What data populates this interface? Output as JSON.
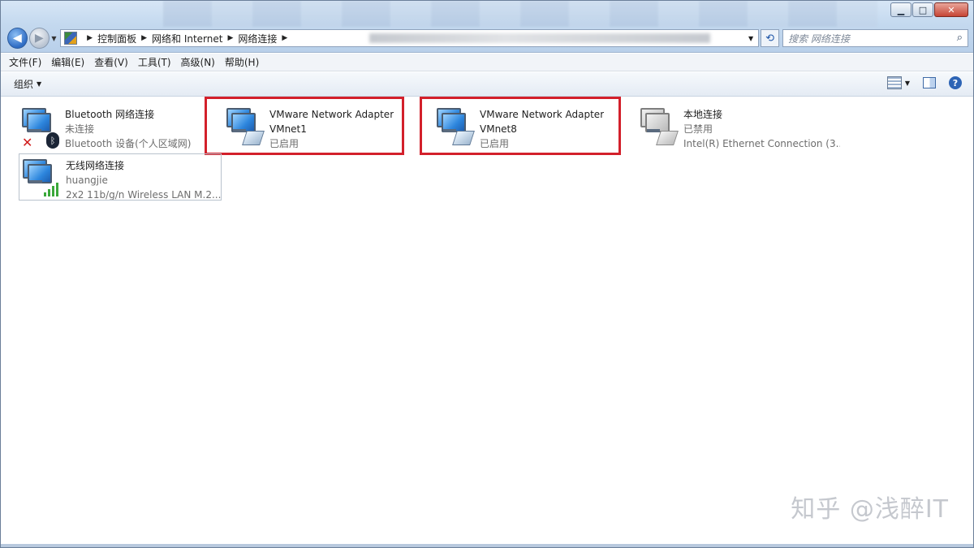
{
  "window": {
    "caption_buttons": [
      "minimize",
      "maximize",
      "close"
    ]
  },
  "nav": {
    "breadcrumbs": [
      "控制面板",
      "网络和 Internet",
      "网络连接"
    ],
    "search_placeholder": "搜索 网络连接"
  },
  "menu": [
    "文件(F)",
    "编辑(E)",
    "查看(V)",
    "工具(T)",
    "高级(N)",
    "帮助(H)"
  ],
  "toolbar": {
    "organize_label": "组织"
  },
  "connections": [
    {
      "name": "Bluetooth 网络连接",
      "status": "未连接",
      "device": "Bluetooth 设备(个人区域网)",
      "icon": "bluetooth-disconnected-icon"
    },
    {
      "name": "VMware Network Adapter",
      "status": "VMnet1",
      "device": "已启用",
      "icon": "network-adapter-icon",
      "highlighted": true
    },
    {
      "name": "VMware Network Adapter",
      "status": "VMnet8",
      "device": "已启用",
      "icon": "network-adapter-icon",
      "highlighted": true
    },
    {
      "name": "本地连接",
      "status": "已禁用",
      "device": "Intel(R) Ethernet Connection (3...",
      "icon": "network-adapter-disabled-icon"
    },
    {
      "name": "无线网络连接",
      "status": "huangjie",
      "device": "2x2 11b/g/n Wireless LAN M.2...",
      "icon": "wireless-signal-icon",
      "selected": true
    }
  ],
  "watermark": "知乎 @浅醉IT",
  "colors": {
    "highlight": "#d3202b",
    "aero": "#c4d9ef"
  }
}
